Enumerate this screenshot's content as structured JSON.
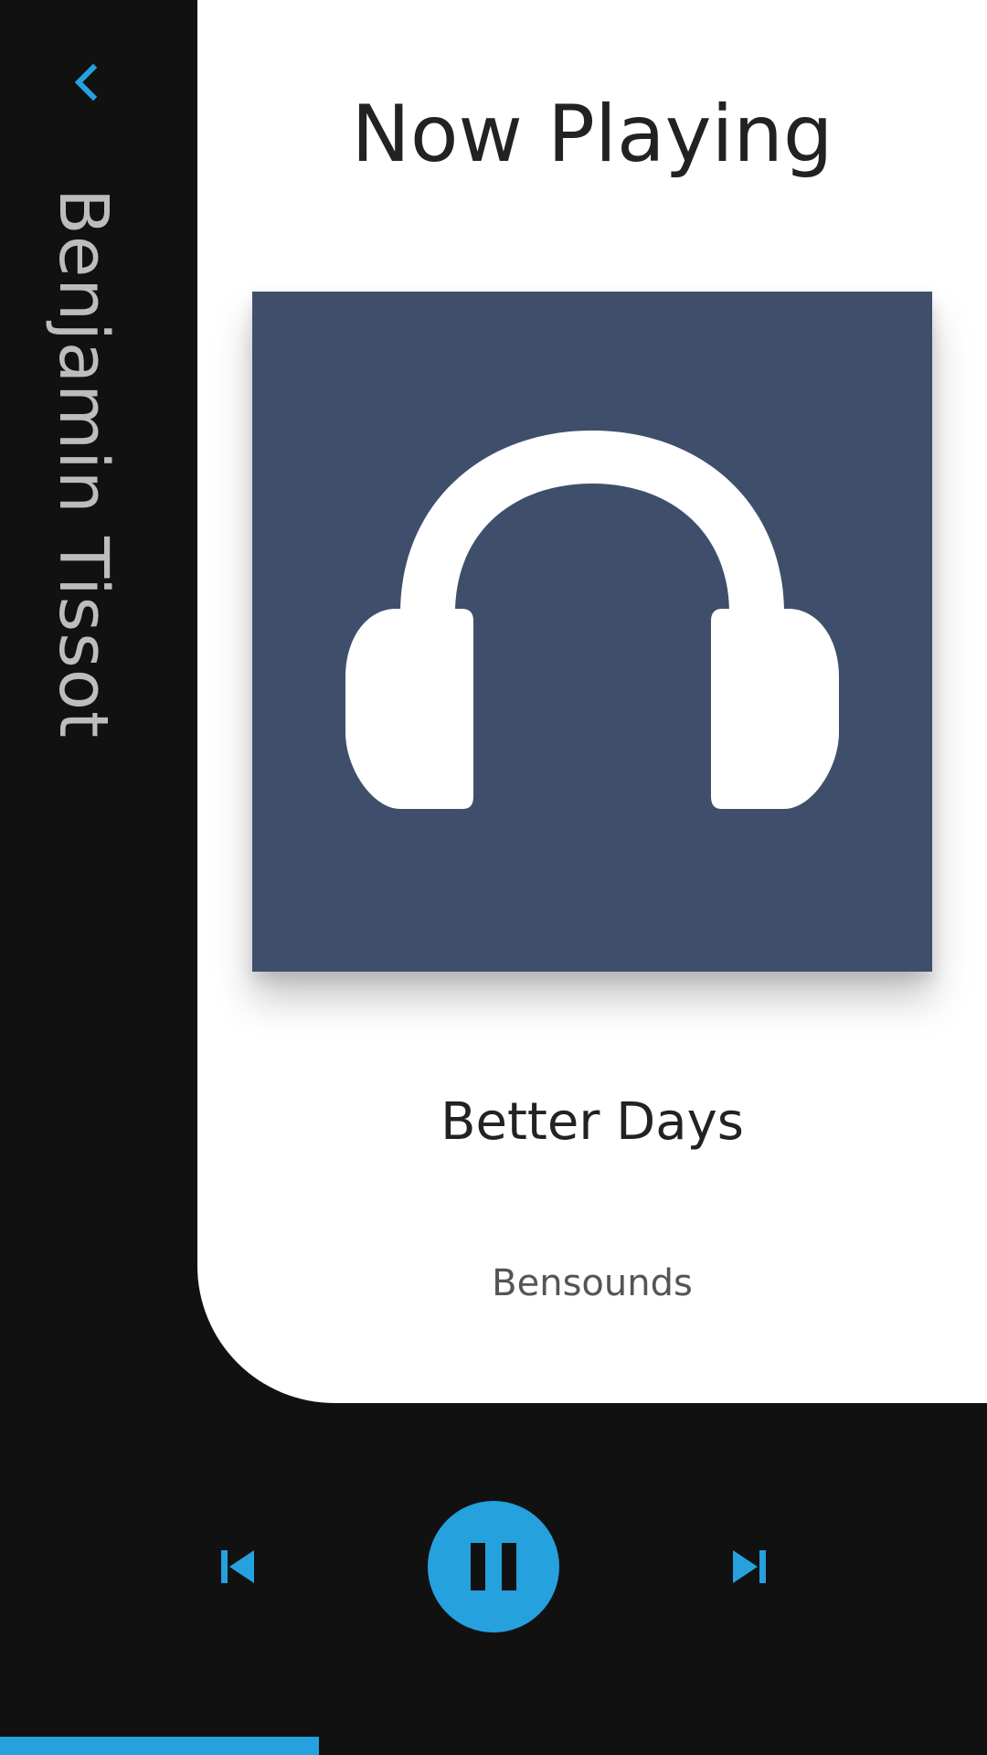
{
  "header": {
    "title": "Now Playing",
    "back_icon": "chevron-left-icon"
  },
  "sidebar": {
    "artist_vertical": "Benjamin Tissot"
  },
  "track": {
    "title": "Better Days",
    "artist": "Bensounds",
    "artwork_icon": "headphones-icon"
  },
  "controls": {
    "previous_icon": "skip-previous-icon",
    "play_pause_icon": "pause-icon",
    "next_icon": "skip-next-icon",
    "is_playing": true
  },
  "progress": {
    "fraction": 0.323
  },
  "colors": {
    "accent": "#25a1de",
    "background": "#111111",
    "card": "#ffffff",
    "artwork_bg": "#3f4f6b",
    "vertical_text": "#bdbdbd"
  }
}
